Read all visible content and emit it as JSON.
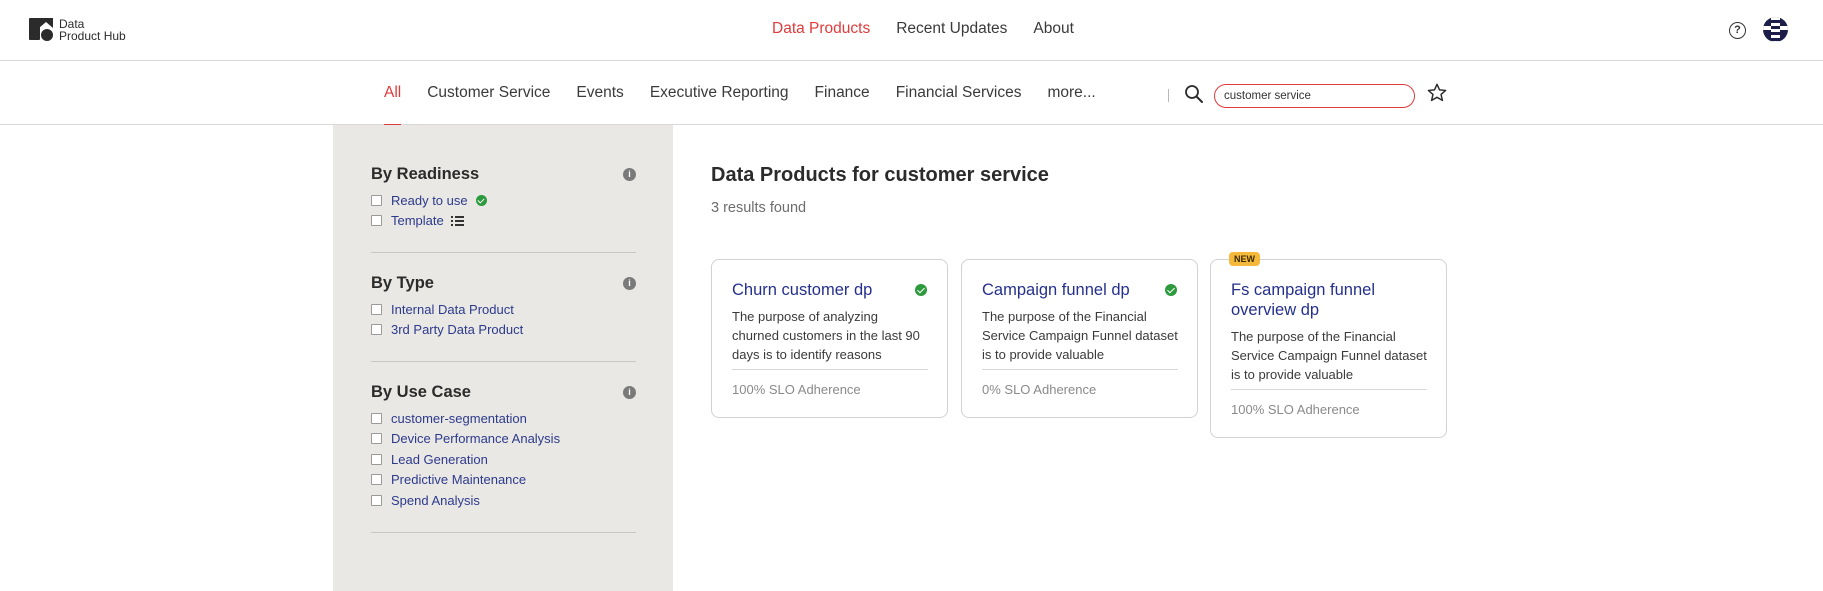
{
  "header": {
    "logo_line1": "Data",
    "logo_line2": "Product Hub",
    "nav": [
      "Data Products",
      "Recent Updates",
      "About"
    ],
    "active_nav": "Data Products",
    "help_icon": "question-circle-icon",
    "avatar_icon": "user-avatar"
  },
  "categories": {
    "tabs": [
      "All",
      "Customer Service",
      "Events",
      "Executive Reporting",
      "Finance",
      "Financial Services",
      "more..."
    ],
    "active": "All",
    "search_value": "customer service",
    "search_icon": "magnifier-icon",
    "favorite_icon": "star-icon"
  },
  "filters": {
    "readiness": {
      "title": "By Readiness",
      "options": [
        "Ready to use",
        "Template"
      ]
    },
    "type": {
      "title": "By Type",
      "options": [
        "Internal Data Product",
        "3rd Party Data Product"
      ]
    },
    "use_case": {
      "title": "By Use Case",
      "options": [
        "customer-segmentation",
        "Device Performance Analysis",
        "Lead Generation",
        "Predictive Maintenance",
        "Spend Analysis"
      ]
    },
    "info_symbol": "i"
  },
  "main": {
    "title": "Data Products for customer service",
    "result_count": "3 results found"
  },
  "cards": [
    {
      "title": "Churn customer dp",
      "description": "The purpose of analyzing churned customers in the last 90 days is to identify reasons",
      "slo": "100% SLO Adherence",
      "ready": true,
      "badge": ""
    },
    {
      "title": "Campaign funnel dp",
      "description": "The purpose of the Financial Service Campaign Funnel dataset is to provide valuable",
      "slo": "0% SLO Adherence",
      "ready": true,
      "badge": ""
    },
    {
      "title": "Fs campaign funnel overview dp",
      "description": "The purpose of the Financial Service Campaign Funnel dataset is to provide valuable",
      "slo": "100% SLO Adherence",
      "ready": false,
      "badge": "NEW"
    }
  ],
  "colors": {
    "accent": "#e03b3b",
    "link": "#24308c",
    "success": "#2e9a3e",
    "new_badge": "#f4b93a",
    "sidebar_bg": "#eae8e5"
  }
}
